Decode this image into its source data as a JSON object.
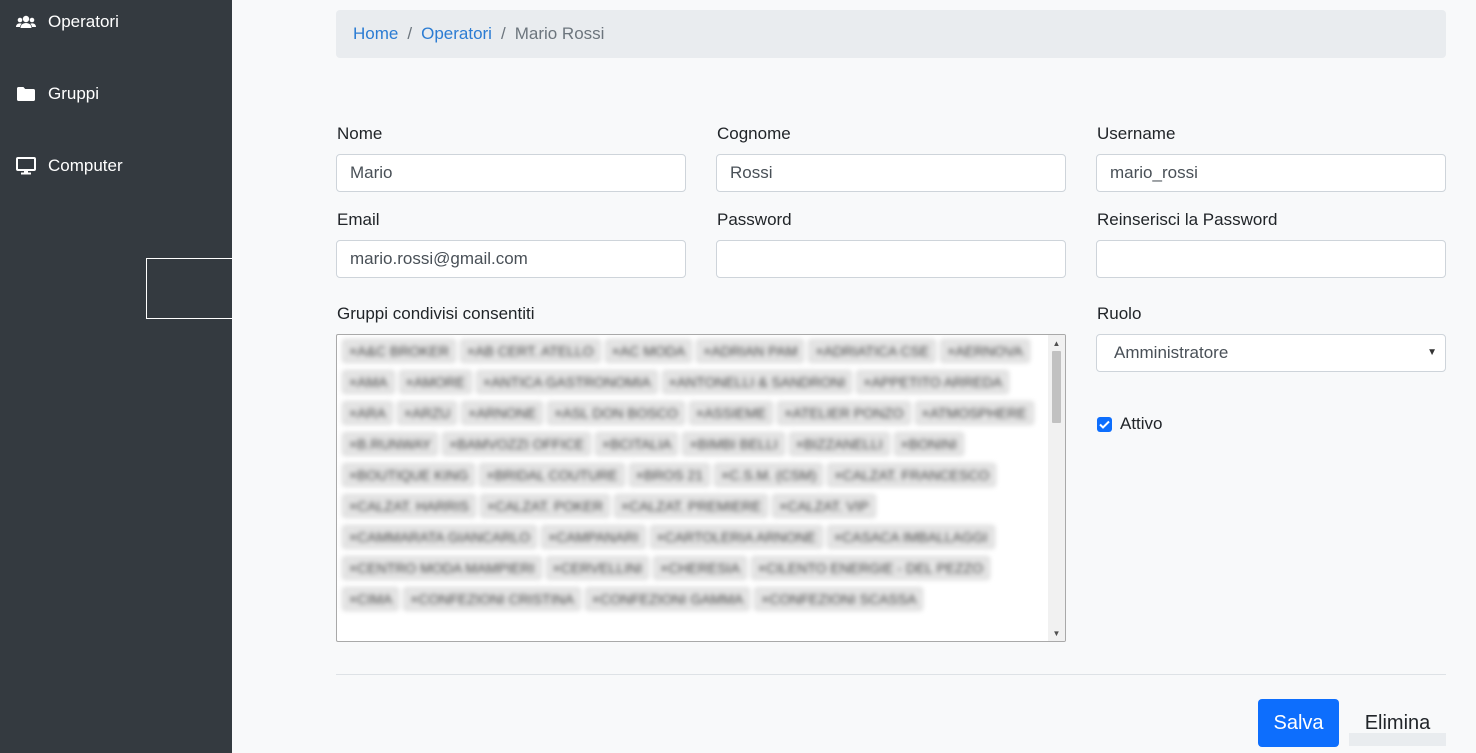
{
  "sidebar": {
    "items": [
      {
        "label": "Operatori",
        "icon": "users-icon"
      },
      {
        "label": "Gruppi",
        "icon": "folder-icon"
      },
      {
        "label": "Computer",
        "icon": "desktop-icon"
      }
    ]
  },
  "breadcrumb": {
    "home": "Home",
    "section": "Operatori",
    "current": "Mario Rossi",
    "separator": "/"
  },
  "form": {
    "nome_label": "Nome",
    "nome_value": "Mario",
    "cognome_label": "Cognome",
    "cognome_value": "Rossi",
    "username_label": "Username",
    "username_value": "mario_rossi",
    "email_label": "Email",
    "email_value": "mario.rossi@gmail.com",
    "password_label": "Password",
    "password_value": "",
    "repassword_label": "Reinserisci la Password",
    "repassword_value": "",
    "gruppi_label": "Gruppi condivisi consentiti",
    "gruppi_tags": [
      "×A&C BROKER",
      "×AB CERT. ATELLO",
      "×AC MODA",
      "×ADRIAN PAM",
      "×ADRIATICA CSE",
      "×AERNOVA",
      "×AMA",
      "×AMORE",
      "×ANTICA GASTRONOMIA",
      "×ANTONELLI & SANDRONI",
      "×APPETITO ARREDA",
      "×ARA",
      "×ARZU",
      "×ARNONE",
      "×ASL DON BOSCO",
      "×ASSIEME",
      "×ATELIER PONZO",
      "×ATMOSPHERE",
      "×B.RUNWAY",
      "×BAMVOZZI OFFICE",
      "×BCITALIA",
      "×BIMBI BELLI",
      "×BIZZANELLI",
      "×BONINI",
      "×BOUTIQUE KING",
      "×BRIDAL COUTURE",
      "×BROS 21",
      "×C.S.M. (CSM)",
      "×CALZAT. FRANCESCO",
      "×CALZAT. HARRIS",
      "×CALZAT. POKER",
      "×CALZAT. PREMIERE",
      "×CALZAT. VIP",
      "×CAMMARATA GIANCARLO",
      "×CAMPANARI",
      "×CARTOLERIA ARNONE",
      "×CASACA IMBALLAGGI",
      "×CENTRO MODA MAMPIERI",
      "×CERVELLINI",
      "×CHERESIA",
      "×CILENTO ENERGIE - DEL PEZZO",
      "×CIMA",
      "×CONFEZIONI CRISTINA",
      "×CONFEZIONI GAMMA",
      "×CONFEZIONI SCASSA"
    ],
    "ruolo_label": "Ruolo",
    "ruolo_value": "Amministratore",
    "attivo_label": "Attivo",
    "attivo_checked": true
  },
  "actions": {
    "save_label": "Salva",
    "delete_label": "Elimina"
  },
  "colors": {
    "sidebar_bg": "#343a40",
    "primary": "#0d6efd",
    "link": "#2b7cd3"
  }
}
